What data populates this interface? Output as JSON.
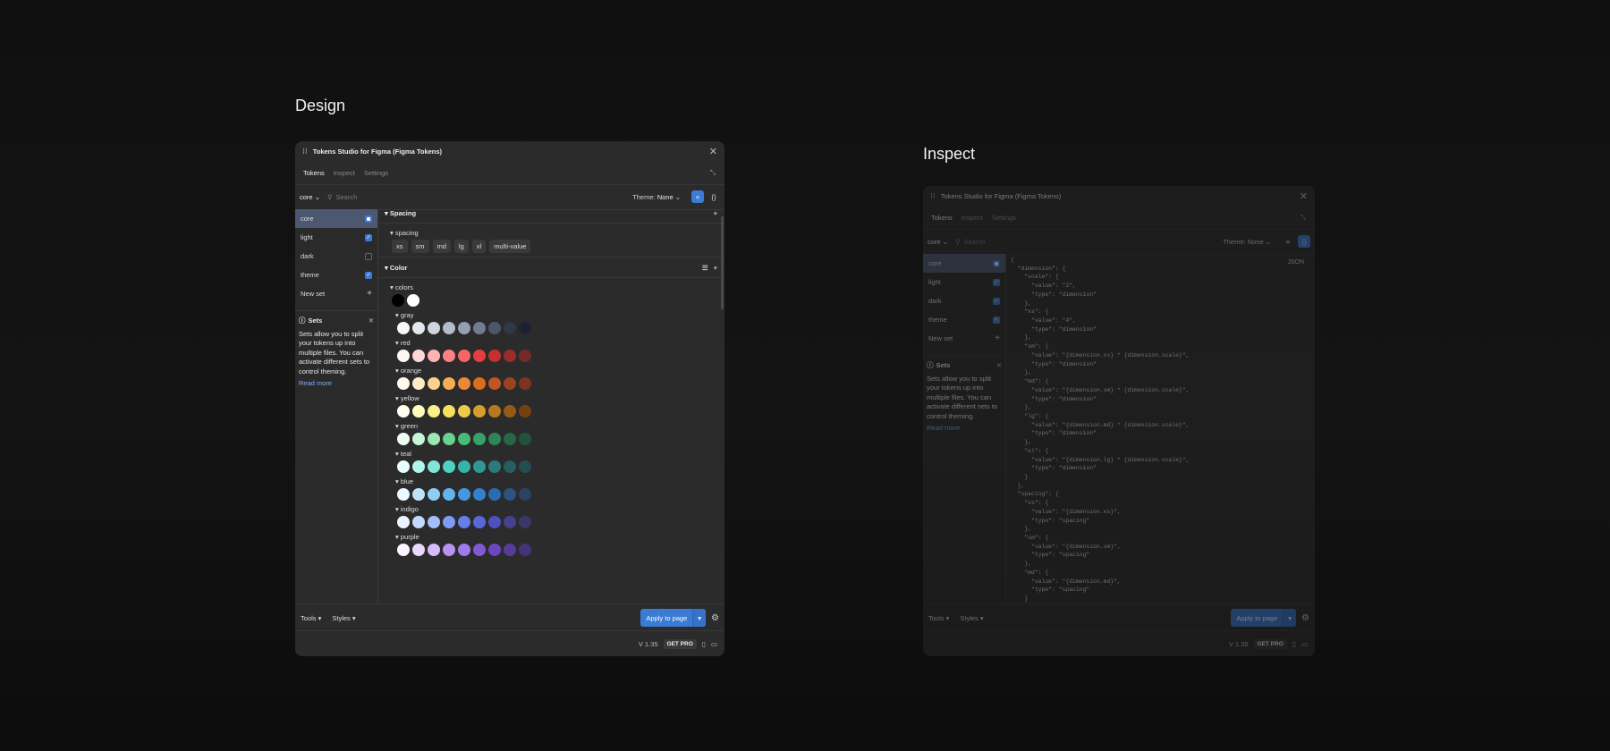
{
  "headings": {
    "design": "Design",
    "inspect": "Inspect"
  },
  "plugin": {
    "title": "Tokens Studio for Figma (Figma Tokens)",
    "tabs": [
      "Tokens",
      "Inspect",
      "Settings"
    ],
    "active_set_select": "core",
    "search_placeholder": "Search",
    "theme_label": "Theme:",
    "theme_value": "None",
    "sets": [
      {
        "name": "core",
        "state": "partial"
      },
      {
        "name": "light",
        "state": "on"
      },
      {
        "name": "dark",
        "state": "off"
      },
      {
        "name": "theme",
        "state": "on"
      }
    ],
    "new_set": "New set",
    "info": {
      "title": "Sets",
      "body": "Sets allow you to split your tokens up into multiple files. You can activate different sets to control theming.",
      "link": "Read more"
    },
    "spacing_group": "Spacing",
    "spacing_sub": "spacing",
    "spacing_tokens": [
      "xs",
      "sm",
      "md",
      "lg",
      "xl",
      "multi-value"
    ],
    "color_group": "Color",
    "colors_sub": "colors",
    "base_colors": [
      "#000000",
      "#ffffff"
    ],
    "palettes": [
      {
        "name": "gray",
        "colors": [
          "#f7f8fa",
          "#e4e7ec",
          "#cfd5de",
          "#b3bcc9",
          "#949fb0",
          "#6f7c91",
          "#4b566a",
          "#2f3748",
          "#1b2130"
        ]
      },
      {
        "name": "red",
        "colors": [
          "#fff5f5",
          "#fed7d7",
          "#feb2b2",
          "#fc8181",
          "#f56565",
          "#e53e3e",
          "#c53030",
          "#9b2c2c",
          "#742a2a"
        ]
      },
      {
        "name": "orange",
        "colors": [
          "#fffaf0",
          "#feebc8",
          "#fbd38d",
          "#f6ad55",
          "#ed8936",
          "#dd6b20",
          "#c05621",
          "#9c4221",
          "#7b341e"
        ]
      },
      {
        "name": "yellow",
        "colors": [
          "#fffff0",
          "#fefcbf",
          "#faf089",
          "#f6e05e",
          "#ecc94b",
          "#d69e2e",
          "#b7791f",
          "#975a16",
          "#744210"
        ]
      },
      {
        "name": "green",
        "colors": [
          "#f0fff4",
          "#c6f6d5",
          "#9ae6b4",
          "#68d391",
          "#48bb78",
          "#38a169",
          "#2f855a",
          "#276749",
          "#22543d"
        ]
      },
      {
        "name": "teal",
        "colors": [
          "#e6fffa",
          "#b2f5ea",
          "#81e6d9",
          "#4fd1c5",
          "#38b2ac",
          "#319795",
          "#2c7a7b",
          "#285e61",
          "#234e52"
        ]
      },
      {
        "name": "blue",
        "colors": [
          "#ebf8ff",
          "#bee3f8",
          "#90cdf4",
          "#63b3ed",
          "#4299e1",
          "#3182ce",
          "#2b6cb0",
          "#2c5282",
          "#2a4365"
        ]
      },
      {
        "name": "indigo",
        "colors": [
          "#ebf4ff",
          "#c3dafe",
          "#a3bffa",
          "#7f9cf5",
          "#667eea",
          "#5a67d8",
          "#4c51bf",
          "#434190",
          "#3c366b"
        ]
      },
      {
        "name": "purple",
        "colors": [
          "#faf5ff",
          "#e9d8fd",
          "#d6bcfa",
          "#b794f4",
          "#9f7aea",
          "#805ad5",
          "#6b46c1",
          "#553c9a",
          "#44337a"
        ]
      }
    ],
    "tools_menu": "Tools",
    "styles_menu": "Styles",
    "apply_button": "Apply to page",
    "version": "V 1.35",
    "get_pro": "GET PRO",
    "json_label": "JSON",
    "json_text": "{\n  \"dimension\": {\n    \"scale\": {\n      \"value\": \"2\",\n      \"type\": \"dimension\"\n    },\n    \"xs\": {\n      \"value\": \"4\",\n      \"type\": \"dimension\"\n    },\n    \"sm\": {\n      \"value\": \"{dimension.xs} * {dimension.scale}\",\n      \"type\": \"dimension\"\n    },\n    \"md\": {\n      \"value\": \"{dimension.sm} * {dimension.scale}\",\n      \"type\": \"dimension\"\n    },\n    \"lg\": {\n      \"value\": \"{dimension.md} * {dimension.scale}\",\n      \"type\": \"dimension\"\n    },\n    \"xl\": {\n      \"value\": \"{dimension.lg} * {dimension.scale}\",\n      \"type\": \"dimension\"\n    }\n  },\n  \"spacing\": {\n    \"xs\": {\n      \"value\": \"{dimension.xs}\",\n      \"type\": \"spacing\"\n    },\n    \"sm\": {\n      \"value\": \"{dimension.sm}\",\n      \"type\": \"spacing\"\n    },\n    \"md\": {\n      \"value\": \"{dimension.md}\",\n      \"type\": \"spacing\"\n    }"
  }
}
